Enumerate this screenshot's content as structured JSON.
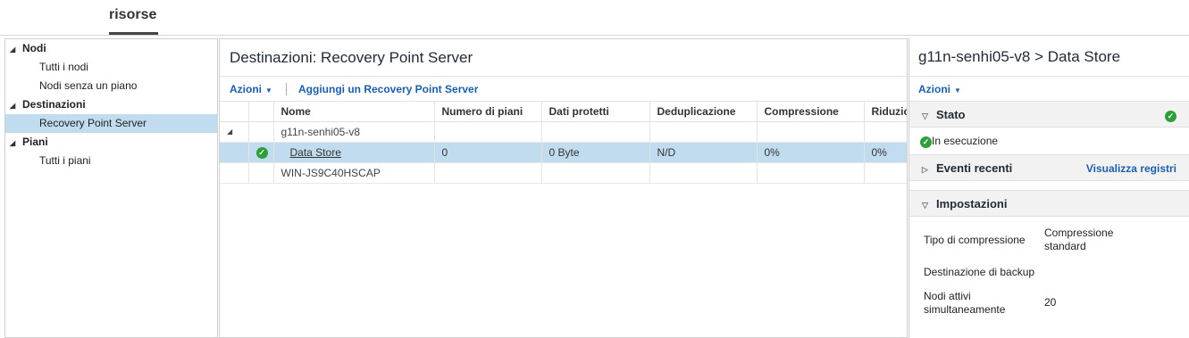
{
  "top_tab": {
    "label": "risorse"
  },
  "sidebar": {
    "groups": [
      {
        "label": "Nodi",
        "items": [
          {
            "label": "Tutti i nodi"
          },
          {
            "label": "Nodi senza un piano"
          }
        ]
      },
      {
        "label": "Destinazioni",
        "items": [
          {
            "label": "Recovery Point Server"
          }
        ]
      },
      {
        "label": "Piani",
        "items": [
          {
            "label": "Tutti i piani"
          }
        ]
      }
    ]
  },
  "main": {
    "title": "Destinazioni: Recovery Point Server",
    "toolbar": {
      "actions_label": "Azioni",
      "add_label": "Aggiungi un Recovery Point Server"
    },
    "table": {
      "columns": [
        "Nome",
        "Numero di piani",
        "Dati protetti",
        "Deduplicazione",
        "Compressione",
        "Riduzio"
      ],
      "group_row": "g11n-senhi05-v8",
      "selected_row": {
        "name": "Data Store",
        "plans": "0",
        "protected": "0 Byte",
        "dedup": "N/D",
        "compression": "0%",
        "reduction": "0%"
      },
      "other_row": "WIN-JS9C40HSCAP"
    }
  },
  "right": {
    "title": "g11n-senhi05-v8 > Data Store",
    "actions_label": "Azioni",
    "status": {
      "heading": "Stato",
      "value": "In esecuzione"
    },
    "events": {
      "heading": "Eventi recenti",
      "link": "Visualizza registri"
    },
    "settings": {
      "heading": "Impostazioni",
      "rows": [
        {
          "key": "Tipo di compressione",
          "value": "Compressione standard"
        },
        {
          "key": "Destinazione di backup",
          "value": ""
        },
        {
          "key": "Nodi attivi simultaneamente",
          "value": "20"
        }
      ]
    }
  },
  "colors": {
    "selection": "#c2dcef",
    "link": "#1d5fa7",
    "ok_green": "#2e9e3a"
  }
}
